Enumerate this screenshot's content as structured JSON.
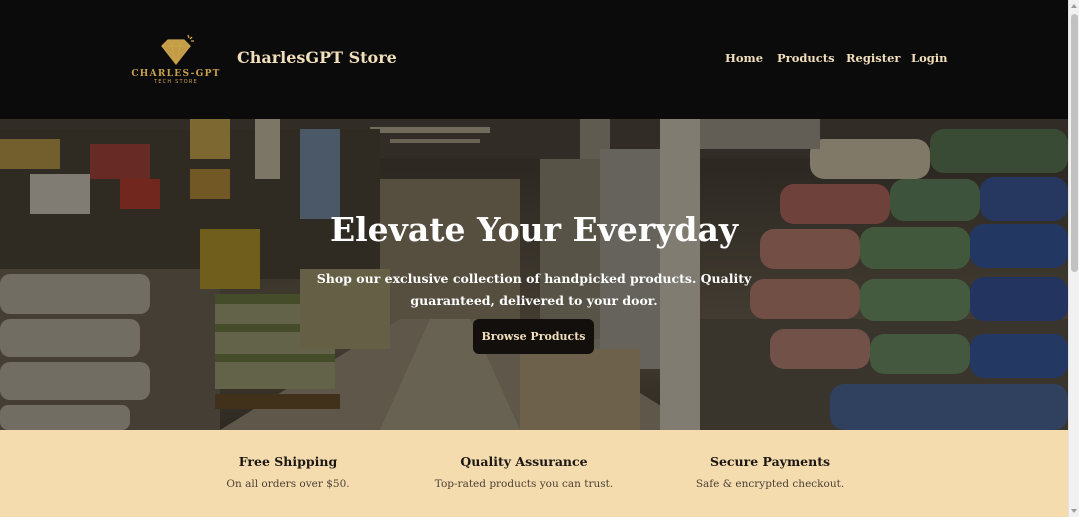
{
  "header": {
    "logo": {
      "main": "CHARLES-GPT",
      "sub": "TECH STORE",
      "icon": "diamond-icon",
      "color": "#c9a24c"
    },
    "brand": "CharlesGPT Store",
    "nav": [
      {
        "label": "Home"
      },
      {
        "label": "Products"
      },
      {
        "label": "Register"
      },
      {
        "label": "Login"
      }
    ]
  },
  "hero": {
    "title": "Elevate Your Everyday",
    "subtitle": "Shop our exclusive collection of handpicked products. Quality guaranteed, delivered to your door.",
    "cta_label": "Browse Products"
  },
  "features": [
    {
      "title": "Free Shipping",
      "description": "On all orders over $50."
    },
    {
      "title": "Quality Assurance",
      "description": "Top-rated products you can trust."
    },
    {
      "title": "Secure Payments",
      "description": "Safe & encrypted checkout."
    }
  ],
  "colors": {
    "header_bg": "#0c0b0b",
    "header_text": "#f1dfbc",
    "feature_band_bg": "#f4dcaf",
    "button_bg": "#120f0d"
  }
}
